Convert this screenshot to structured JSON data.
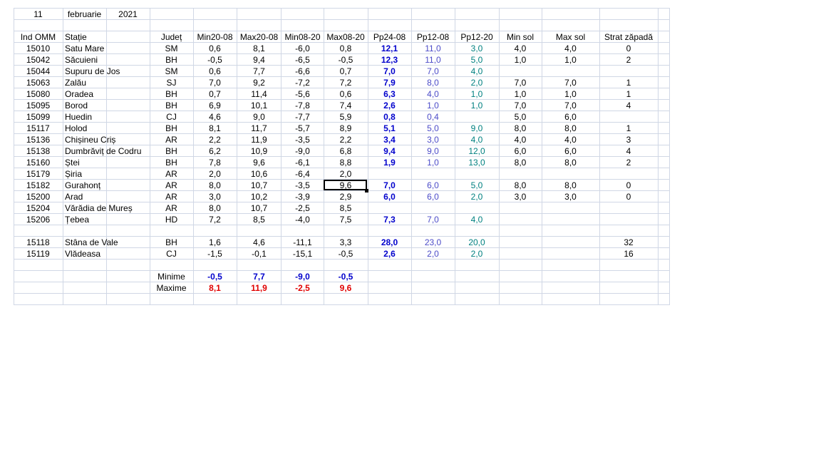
{
  "date": {
    "day": "11",
    "month": "februarie",
    "year": "2021"
  },
  "headers": [
    "Ind OMM",
    "Stație",
    "Județ",
    "Min20-08",
    "Max20-08",
    "Min08-20",
    "Max08-20",
    "Pp24-08",
    "Pp12-08",
    "Pp12-20",
    "Min sol",
    "Max sol",
    "Strat zăpadă"
  ],
  "rows": [
    [
      "15010",
      "Satu Mare",
      "SM",
      "0,6",
      "8,1",
      "-6,0",
      "0,8",
      "12,1",
      "11,0",
      "3,0",
      "4,0",
      "4,0",
      "0"
    ],
    [
      "15042",
      "Săcuieni",
      "BH",
      "-0,5",
      "9,4",
      "-6,5",
      "-0,5",
      "12,3",
      "11,0",
      "5,0",
      "1,0",
      "1,0",
      "2"
    ],
    [
      "15044",
      "Supuru de Jos",
      "SM",
      "0,6",
      "7,7",
      "-6,6",
      "0,7",
      "7,0",
      "7,0",
      "4,0",
      "",
      "",
      ""
    ],
    [
      "15063",
      "Zalău",
      "SJ",
      "7,0",
      "9,2",
      "-7,2",
      "7,2",
      "7,9",
      "8,0",
      "2,0",
      "7,0",
      "7,0",
      "1"
    ],
    [
      "15080",
      "Oradea",
      "BH",
      "0,7",
      "11,4",
      "-5,6",
      "0,6",
      "6,3",
      "4,0",
      "1,0",
      "1,0",
      "1,0",
      "1"
    ],
    [
      "15095",
      "Borod",
      "BH",
      "6,9",
      "10,1",
      "-7,8",
      "7,4",
      "2,6",
      "1,0",
      "1,0",
      "7,0",
      "7,0",
      "4"
    ],
    [
      "15099",
      "Huedin",
      "CJ",
      "4,6",
      "9,0",
      "-7,7",
      "5,9",
      "0,8",
      "0,4",
      "",
      "5,0",
      "6,0",
      ""
    ],
    [
      "15117",
      "Holod",
      "BH",
      "8,1",
      "11,7",
      "-5,7",
      "8,9",
      "5,1",
      "5,0",
      "9,0",
      "8,0",
      "8,0",
      "1"
    ],
    [
      "15136",
      "Chișineu   Criș",
      "AR",
      "2,2",
      "11,9",
      "-3,5",
      "2,2",
      "3,4",
      "3,0",
      "4,0",
      "4,0",
      "4,0",
      "3"
    ],
    [
      "15138",
      "Dumbrăviț  de Codru",
      "BH",
      "6,2",
      "10,9",
      "-9,0",
      "6,8",
      "9,4",
      "9,0",
      "12,0",
      "6,0",
      "6,0",
      "4"
    ],
    [
      "15160",
      "Ștei",
      "BH",
      "7,8",
      "9,6",
      "-6,1",
      "8,8",
      "1,9",
      "1,0",
      "13,0",
      "8,0",
      "8,0",
      "2"
    ],
    [
      "15179",
      "Șiria",
      "AR",
      "2,0",
      "10,6",
      "-6,4",
      "2,0",
      "",
      "",
      "",
      "",
      "",
      ""
    ],
    [
      "15182",
      "Gurahonț",
      "AR",
      "8,0",
      "10,7",
      "-3,5",
      "9,6",
      "7,0",
      "6,0",
      "5,0",
      "8,0",
      "8,0",
      "0"
    ],
    [
      "15200",
      "Arad",
      "AR",
      "3,0",
      "10,2",
      "-3,9",
      "2,9",
      "6,0",
      "6,0",
      "2,0",
      "3,0",
      "3,0",
      "0"
    ],
    [
      "15204",
      "Vărădia de Mureș",
      "AR",
      "8,0",
      "10,7",
      "-2,5",
      "8,5",
      "",
      "",
      "",
      "",
      "",
      ""
    ],
    [
      "15206",
      "Țebea",
      "HD",
      "7,2",
      "8,5",
      "-4,0",
      "7,5",
      "7,3",
      "7,0",
      "4,0",
      "",
      "",
      ""
    ],
    [
      "",
      "",
      "",
      "",
      "",
      "",
      "",
      "",
      "",
      "",
      "",
      "",
      ""
    ],
    [
      "15118",
      "Stâna de Vale",
      "BH",
      "1,6",
      "4,6",
      "-11,1",
      "3,3",
      "28,0",
      "23,0",
      "20,0",
      "",
      "",
      "32"
    ],
    [
      "15119",
      "Vlădeasa",
      "CJ",
      "-1,5",
      "-0,1",
      "-15,1",
      "-0,5",
      "2,6",
      "2,0",
      "2,0",
      "",
      "",
      "16"
    ]
  ],
  "summary": {
    "min_label": "Minime",
    "max_label": "Maxime",
    "min_values": [
      "-0,5",
      "7,7",
      "-9,0",
      "-0,5"
    ],
    "max_values": [
      "8,1",
      "11,9",
      "-2,5",
      "9,6"
    ]
  },
  "colors": {
    "gridline": "#d0d7e5",
    "bold_blue": "#0000cc",
    "indigo": "#4b4bc8",
    "teal": "#008080",
    "red": "#e00000"
  }
}
